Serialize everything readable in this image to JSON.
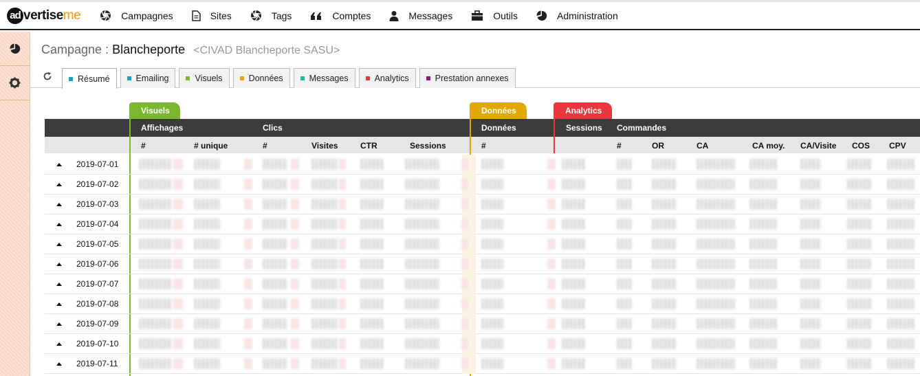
{
  "brand": {
    "ad": "ad",
    "vertise": "vertise",
    "me": "me"
  },
  "nav": [
    {
      "label": "Campagnes",
      "icon": "aperture-icon"
    },
    {
      "label": "Sites",
      "icon": "file-icon"
    },
    {
      "label": "Tags",
      "icon": "aperture-icon"
    },
    {
      "label": "Comptes",
      "icon": "quote-icon"
    },
    {
      "label": "Messages",
      "icon": "user-icon"
    },
    {
      "label": "Outils",
      "icon": "briefcase-icon"
    },
    {
      "label": "Administration",
      "icon": "pie-chart-icon"
    }
  ],
  "page": {
    "prefix": "Campagne : ",
    "name": "Blancheporte",
    "subtitle": "<CIVAD Blancheporte SASU>"
  },
  "tabs": [
    {
      "label": "Résumé",
      "color": "#1ba3c6"
    },
    {
      "label": "Emailing",
      "color": "#1ba3c6"
    },
    {
      "label": "Visuels",
      "color": "#7cb82f"
    },
    {
      "label": "Données",
      "color": "#e0a800"
    },
    {
      "label": "Messages",
      "color": "#1abc9c"
    },
    {
      "label": "Analytics",
      "color": "#e8383d"
    },
    {
      "label": "Prestation annexes",
      "color": "#8e1a6e"
    }
  ],
  "groups": {
    "visuels": "Visuels",
    "donnees": "Données",
    "analytics": "Analytics"
  },
  "header1": {
    "affichages": "Affichages",
    "clics": "Clics",
    "donnees": "Données",
    "sessions": "Sessions",
    "commandes": "Commandes"
  },
  "header2": {
    "aff_num": "#",
    "aff_unique": "# unique",
    "clics_num": "#",
    "visites": "Visites",
    "ctr": "CTR",
    "sessions": "Sessions",
    "donnees_num": "#",
    "cmd_num": "#",
    "or": "OR",
    "ca": "CA",
    "ca_moy": "CA moy.",
    "ca_visite": "CA/Visite",
    "cos": "COS",
    "cpv": "CPV"
  },
  "rows": [
    "2019-07-01",
    "2019-07-02",
    "2019-07-03",
    "2019-07-04",
    "2019-07-05",
    "2019-07-06",
    "2019-07-07",
    "2019-07-08",
    "2019-07-09",
    "2019-07-10",
    "2019-07-11"
  ],
  "colors": {
    "visuels": "#7cb82f",
    "donnees": "#e0a800",
    "analytics": "#e8383d"
  }
}
